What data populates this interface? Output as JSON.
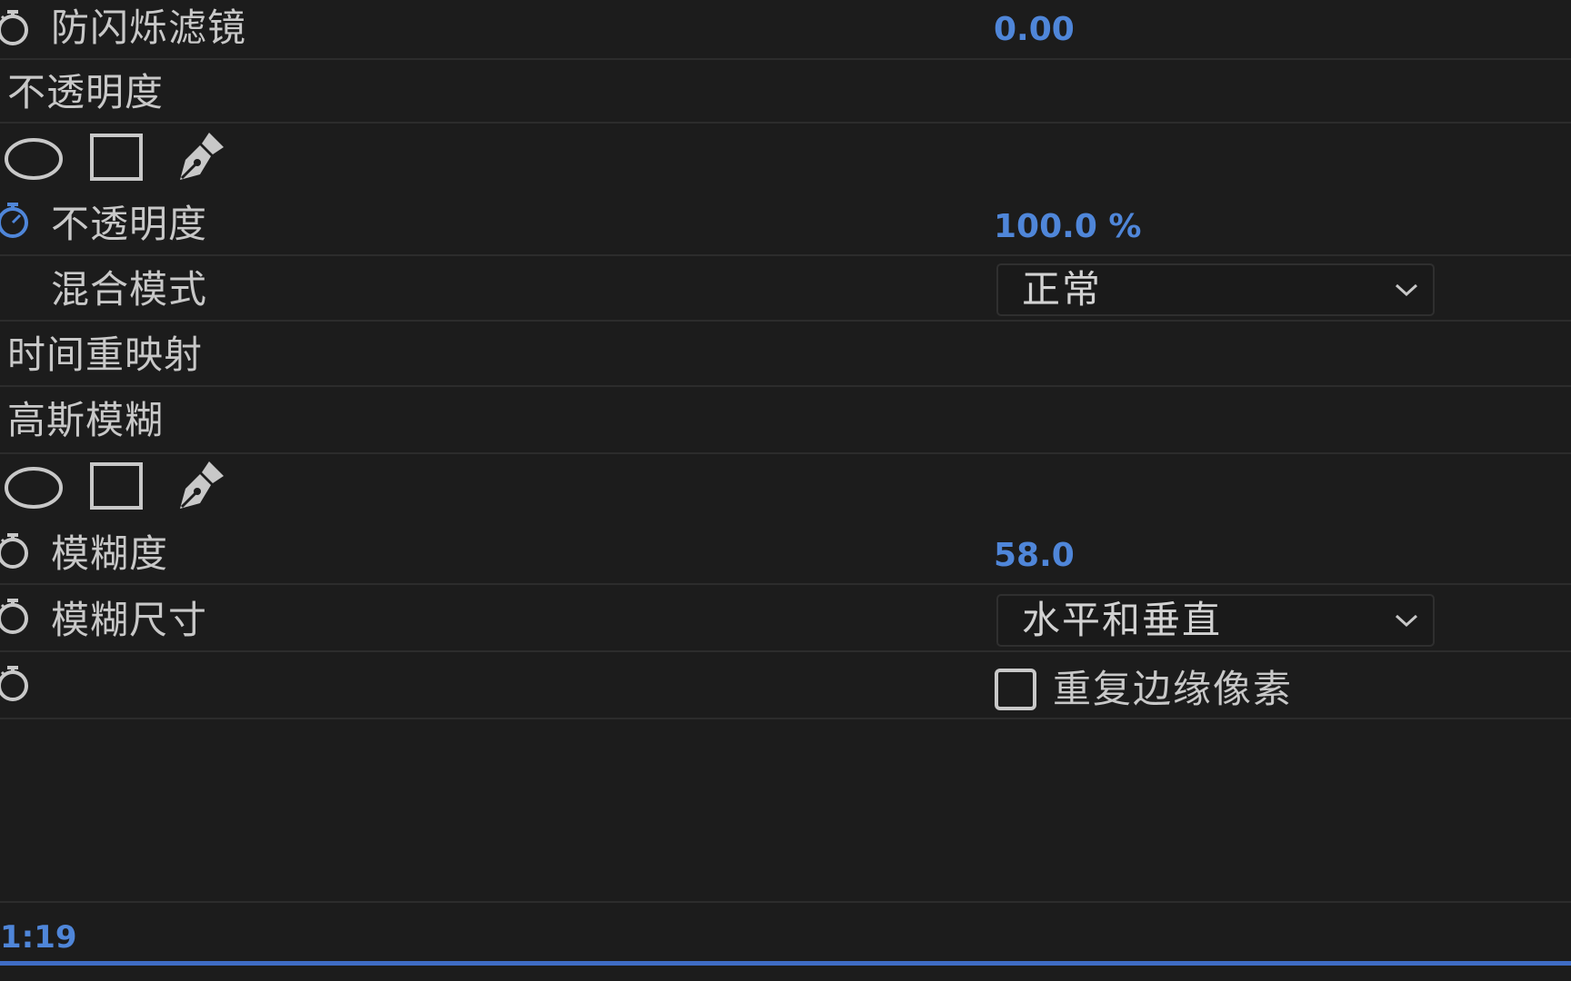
{
  "rows": {
    "antiflicker": {
      "label": "防闪烁滤镜",
      "value": "0.00"
    },
    "opacity_section": {
      "label": "不透明度"
    },
    "opacity": {
      "label": "不透明度",
      "value": "100.0 %"
    },
    "blend_mode": {
      "label": "混合模式",
      "value": "正常"
    },
    "time_remap": {
      "label": "时间重映射"
    },
    "gaussian_section": {
      "label": "高斯模糊"
    },
    "blurriness": {
      "label": "模糊度",
      "value": "58.0"
    },
    "blur_dimensions": {
      "label": "模糊尺寸",
      "value": "水平和垂直"
    },
    "repeat_edge": {
      "label": "重复边缘像素",
      "checked": false
    }
  },
  "mask_tools": [
    "ellipse-mask-icon",
    "rectangle-mask-icon",
    "pen-mask-icon"
  ],
  "footer": {
    "timecode": "1:19"
  },
  "colors": {
    "background": "#1c1c1c",
    "value_blue": "#4f86d9",
    "text": "#c8c8c8",
    "divider": "#2c2c2c",
    "active_stopwatch": "#4f86d9"
  }
}
